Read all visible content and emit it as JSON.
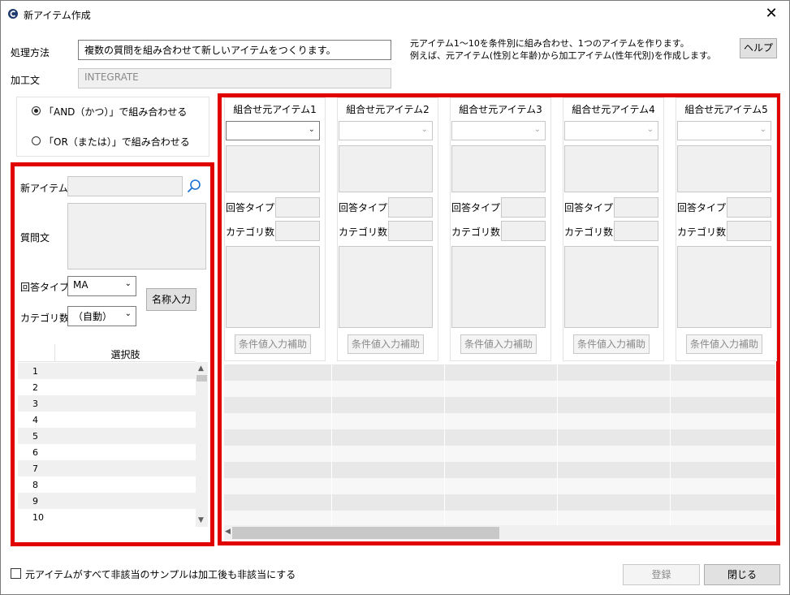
{
  "window": {
    "title": "新アイテム作成",
    "close_glyph": "✕"
  },
  "method": {
    "label": "処理方法",
    "value": "複数の質問を組み合わせて新しいアイテムをつくります。"
  },
  "process": {
    "label": "加工文",
    "value": "INTEGRATE"
  },
  "description": {
    "line1": "元アイテム1～10を条件別に組み合わせ、1つのアイテムを作ります。",
    "line2": "例えば、元アイテム(性別と年齢)から加工アイテム(性年代別)を作成します。"
  },
  "help_button": "ヘルプ",
  "combine_mode": {
    "options": [
      {
        "label": "「AND（かつ）」で組み合わせる",
        "selected": true
      },
      {
        "label": "「OR（または）」で組み合わせる",
        "selected": false
      }
    ]
  },
  "new_item": {
    "label": "新アイテム",
    "question_label": "質問文",
    "answer_type_label": "回答タイプ",
    "answer_type_value": "MA",
    "category_label": "カテゴリ数",
    "category_value": "（自動）",
    "name_input_button": "名称入力",
    "search_icon": "search-icon"
  },
  "choices": {
    "header": "選択肢",
    "rows": [
      "1",
      "2",
      "3",
      "4",
      "5",
      "6",
      "7",
      "8",
      "9",
      "10"
    ]
  },
  "source_items": [
    {
      "title": "組合せ元アイテム1",
      "answer_type_label": "回答タイプ",
      "category_label": "カテゴリ数",
      "button": "条件値入力補助"
    },
    {
      "title": "組合せ元アイテム2",
      "answer_type_label": "回答タイプ",
      "category_label": "カテゴリ数",
      "button": "条件値入力補助"
    },
    {
      "title": "組合せ元アイテム3",
      "answer_type_label": "回答タイプ",
      "category_label": "カテゴリ数",
      "button": "条件値入力補助"
    },
    {
      "title": "組合せ元アイテム4",
      "answer_type_label": "回答タイプ",
      "category_label": "カテゴリ数",
      "button": "条件値入力補助"
    },
    {
      "title": "組合せ元アイテム5",
      "answer_type_label": "回答タイプ",
      "category_label": "カテゴリ数",
      "button": "条件値入力補助"
    }
  ],
  "footer": {
    "checkbox_label": "元アイテムがすべて非該当のサンプルは加工後も非該当にする",
    "register_button": "登録",
    "close_button": "閉じる"
  },
  "colors": {
    "highlight": "#e00000",
    "disabled_field": "#f0f0f0",
    "button": "#e1e1e1"
  }
}
